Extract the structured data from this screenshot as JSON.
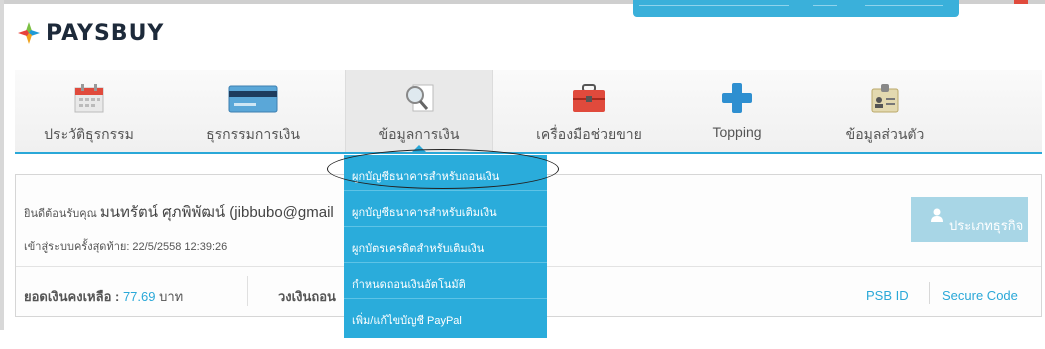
{
  "logo": {
    "text": "PAYSBUY"
  },
  "nav": {
    "tabs": [
      {
        "label": "ประวัติธุรกรรม",
        "icon": "calendar-icon"
      },
      {
        "label": "ธุรกรรมการเงิน",
        "icon": "credit-card-icon"
      },
      {
        "label": "ข้อมูลการเงิน",
        "icon": "magnifier-document-icon"
      },
      {
        "label": "เครื่องมือช่วยขาย",
        "icon": "toolbox-icon"
      },
      {
        "label": "Topping",
        "icon": "plus-icon"
      },
      {
        "label": "ข้อมูลส่วนตัว",
        "icon": "id-badge-icon"
      }
    ],
    "active_index": 2
  },
  "dropdown": {
    "items": [
      "ผูกบัญชีธนาคารสำหรับถอนเงิน",
      "ผูกบัญชีธนาคารสำหรับเติมเงิน",
      "ผูกบัตรเครดิตสำหรับเติมเงิน",
      "กำหนดถอนเงินอัตโนมัติ",
      "เพิ่ม/แก้ไขบัญชี PayPal"
    ]
  },
  "account": {
    "welcome_prefix": "ยินดีต้อนรับคุณ",
    "name": "มนทรัตน์ ศุภพิพัฒน์ (jibbubo@gmail",
    "last_login": "เข้าสู่ระบบครั้งสุดท้าย: 22/5/2558 12:39:26",
    "balance_label": "ยอดเงินคงเหลือ :",
    "balance_value": "77.69",
    "balance_unit": "บาท",
    "withdraw_label": "วงเงินถอน"
  },
  "actions": {
    "business_button": "ประเภทธุรกิจ",
    "psb_id": "PSB ID",
    "secure_code": "Secure Code"
  },
  "colors": {
    "accent": "#2aacdb",
    "business_button": "#a8d6e6"
  }
}
